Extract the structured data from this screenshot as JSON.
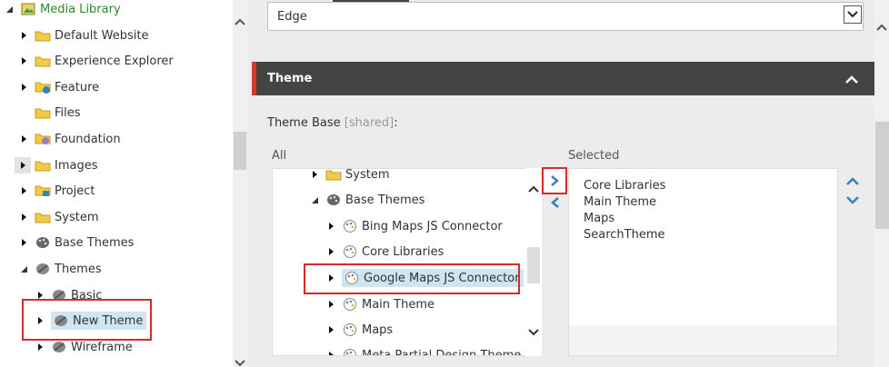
{
  "left_tree": {
    "items": [
      {
        "label": "Media Library",
        "state": "expanded",
        "icon": "media-library-icon"
      },
      {
        "label": "Default Website",
        "state": "collapsed",
        "icon": "folder-icon"
      },
      {
        "label": "Experience Explorer",
        "state": "collapsed",
        "icon": "folder-icon"
      },
      {
        "label": "Feature",
        "state": "collapsed",
        "icon": "folder-feature-icon"
      },
      {
        "label": "Files",
        "state": "leaf",
        "icon": "folder-icon"
      },
      {
        "label": "Foundation",
        "state": "collapsed",
        "icon": "folder-foundation-icon"
      },
      {
        "label": "Images",
        "state": "collapsed",
        "icon": "folder-icon"
      },
      {
        "label": "Project",
        "state": "collapsed",
        "icon": "folder-project-icon"
      },
      {
        "label": "System",
        "state": "collapsed",
        "icon": "folder-icon"
      },
      {
        "label": "Base Themes",
        "state": "collapsed",
        "icon": "palette-icon"
      },
      {
        "label": "Themes",
        "state": "expanded",
        "icon": "palette-icon"
      },
      {
        "label": "Basic",
        "state": "collapsed",
        "icon": "theme-icon"
      },
      {
        "label": "New Theme",
        "state": "collapsed",
        "icon": "theme-icon"
      },
      {
        "label": "Wireframe",
        "state": "collapsed",
        "icon": "theme-icon"
      }
    ]
  },
  "top_select": {
    "value": "Edge"
  },
  "theme_section": {
    "title": "Theme"
  },
  "theme_base": {
    "label": "Theme Base",
    "shared": "[shared]",
    "colon": ":"
  },
  "all_list": {
    "label": "All",
    "items": [
      {
        "label": "System",
        "state": "collapsed",
        "icon": "folder-icon"
      },
      {
        "label": "Base Themes",
        "state": "expanded",
        "icon": "palette-icon"
      },
      {
        "label": "Bing Maps JS Connector",
        "state": "collapsed",
        "icon": "theme-palette-icon"
      },
      {
        "label": "Core Libraries",
        "state": "collapsed",
        "icon": "theme-palette-icon"
      },
      {
        "label": "Google Maps JS Connector",
        "state": "collapsed",
        "icon": "theme-palette-icon"
      },
      {
        "label": "Main Theme",
        "state": "collapsed",
        "icon": "theme-palette-icon"
      },
      {
        "label": "Maps",
        "state": "collapsed",
        "icon": "theme-palette-icon"
      },
      {
        "label": "Meta Partial Design Theme",
        "state": "collapsed",
        "icon": "theme-palette-icon"
      }
    ]
  },
  "selected_list": {
    "label": "Selected",
    "items": [
      "Core Libraries",
      "Main Theme",
      "Maps",
      "SearchTheme"
    ]
  },
  "colors": {
    "accent_red": "#d52b2b",
    "header_bg": "#444444",
    "highlight": "#cde6f2",
    "arrow_blue": "#3a7fc4",
    "tree_green": "#2a8a2a"
  }
}
